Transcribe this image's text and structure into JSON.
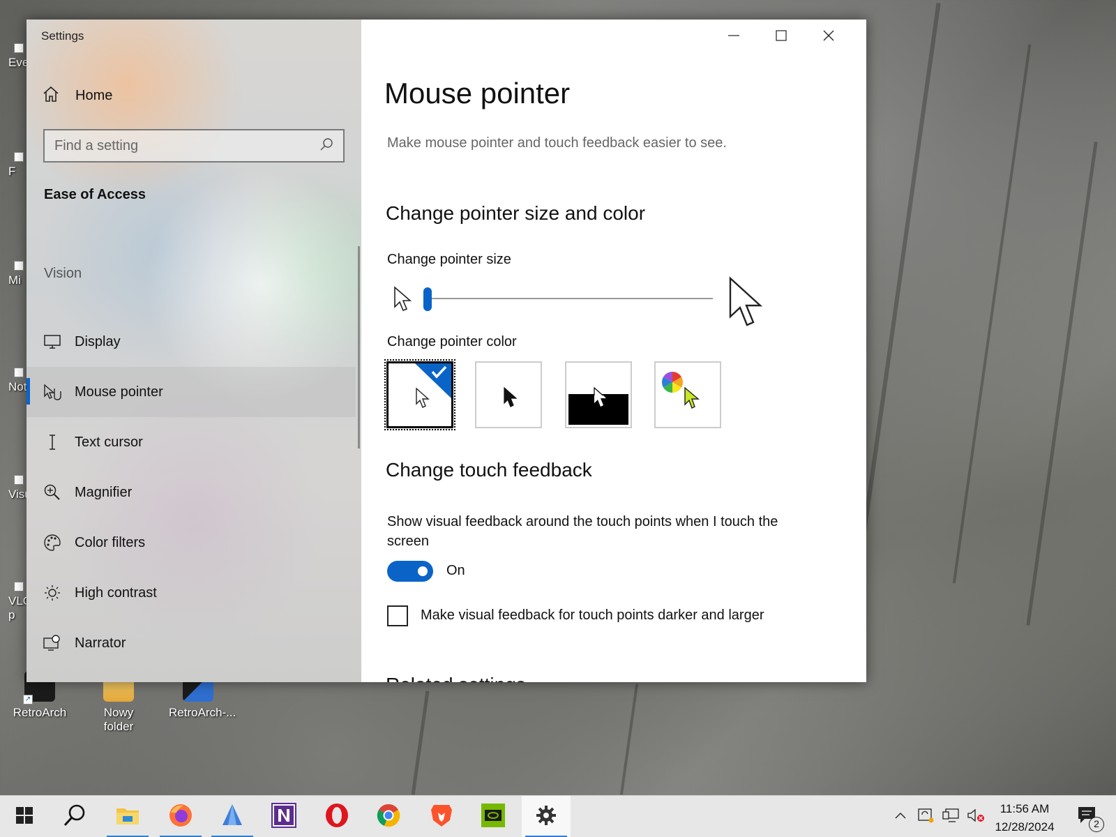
{
  "desktop": {
    "icons": [
      {
        "label": "RetroArch"
      },
      {
        "label": "Nowy folder"
      },
      {
        "label": "RetroArch-..."
      }
    ],
    "edge_labels": [
      "Eve",
      "F",
      "Mi",
      "Not",
      "Visu",
      "VLC\np"
    ]
  },
  "window": {
    "title": "Settings",
    "caption_buttons": [
      "minimize-icon",
      "maximize-icon",
      "close-icon"
    ]
  },
  "sidebar": {
    "home_label": "Home",
    "search_placeholder": "Find a setting",
    "section_title": "Ease of Access",
    "group_title": "Vision",
    "items": [
      {
        "label": "Display",
        "icon": "monitor-icon",
        "active": false
      },
      {
        "label": "Mouse pointer",
        "icon": "mouse-pointer-icon",
        "active": true
      },
      {
        "label": "Text cursor",
        "icon": "text-cursor-icon",
        "active": false
      },
      {
        "label": "Magnifier",
        "icon": "magnifier-icon",
        "active": false
      },
      {
        "label": "Color filters",
        "icon": "palette-icon",
        "active": false
      },
      {
        "label": "High contrast",
        "icon": "sun-icon",
        "active": false
      },
      {
        "label": "Narrator",
        "icon": "narrator-icon",
        "active": false
      }
    ]
  },
  "content": {
    "title": "Mouse pointer",
    "description": "Make mouse pointer and touch feedback easier to see.",
    "pointer_section_title": "Change pointer size and color",
    "size_label": "Change pointer size",
    "size_value": 1,
    "color_label": "Change pointer color",
    "color_options": [
      {
        "name": "white",
        "selected": true
      },
      {
        "name": "black",
        "selected": false
      },
      {
        "name": "inverted",
        "selected": false
      },
      {
        "name": "custom",
        "selected": false
      }
    ],
    "touch_section_title": "Change touch feedback",
    "touch_desc": "Show visual feedback around the touch points when I touch the screen",
    "toggle_state": "On",
    "checkbox_label": "Make visual feedback for touch points darker and larger",
    "checkbox_checked": false,
    "cutoff_heading": "Related settings"
  },
  "taskbar": {
    "apps": [
      "start-icon",
      "search-icon",
      "file-explorer-icon",
      "firefox-icon",
      "app-icon",
      "onenote-icon",
      "opera-icon",
      "chrome-icon",
      "brave-icon",
      "nvidia-icon",
      "settings-icon"
    ],
    "time": "11:56 AM",
    "date": "12/28/2024",
    "notification_count": "2"
  },
  "colors": {
    "accent": "#0a64c8"
  }
}
